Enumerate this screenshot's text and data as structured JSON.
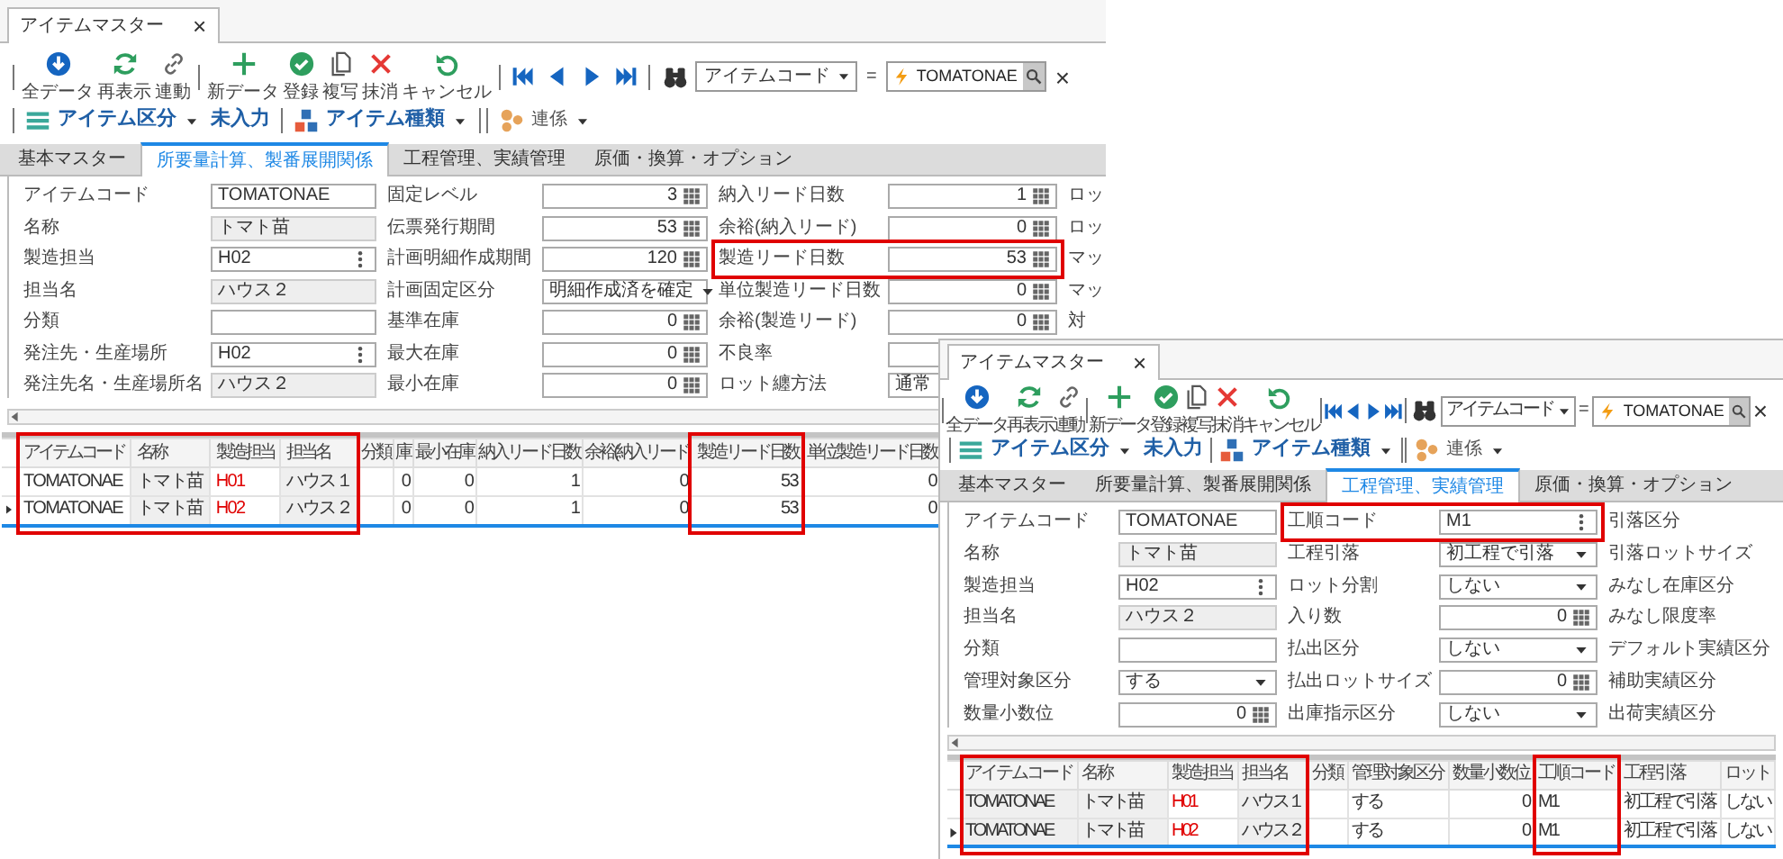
{
  "windows": [
    {
      "title": "アイテムマスター",
      "close": "×",
      "toolbar_groups": [
        [
          {
            "label": "全データ",
            "kind": "download"
          },
          {
            "label": "再表示",
            "kind": "refresh"
          },
          {
            "label": "連動",
            "kind": "link"
          }
        ],
        [
          {
            "label": "新データ",
            "kind": "plus"
          },
          {
            "label": "登録",
            "kind": "check"
          },
          {
            "label": "複写",
            "kind": "copy"
          },
          {
            "label": "抹消",
            "kind": "delete"
          },
          {
            "label": "キャンセル",
            "kind": "undo"
          }
        ]
      ],
      "search": {
        "key": "アイテムコード",
        "operator": "=",
        "value": "TOMATONAE",
        "clear": "×"
      },
      "filters": [
        {
          "label": "アイテム区分",
          "kind": "list"
        },
        {
          "label": "未入力",
          "kind": "plain"
        },
        {
          "label": "アイテム種類",
          "kind": "blocks"
        },
        {
          "label": "連係",
          "kind": "circles"
        }
      ],
      "tabs": [
        {
          "label": "基本マスター",
          "selected": false
        },
        {
          "label": "所要量計算、製番展開関係",
          "selected": true
        },
        {
          "label": "工程管理、実績管理",
          "selected": false
        },
        {
          "label": "原価・換算・オプション",
          "selected": false
        }
      ],
      "form": [
        [
          {
            "label": "アイテムコード",
            "kind": "text",
            "value": "TOMATONAE",
            "highlighted": false
          },
          {
            "label": "名称",
            "kind": "readonly",
            "value": "トマト苗",
            "highlighted": false
          },
          {
            "label": "製造担当",
            "kind": "picker",
            "value": "H02",
            "highlighted": false
          },
          {
            "label": "担当名",
            "kind": "readonly",
            "value": "ハウス２",
            "highlighted": false
          },
          {
            "label": "分類",
            "kind": "text",
            "highlighted": false
          },
          {
            "label": "発注先・生産場所",
            "kind": "picker",
            "value": "H02",
            "highlighted": false
          },
          {
            "label": "発注先名・生産場所名",
            "kind": "readonly",
            "value": "ハウス２",
            "highlighted": false
          }
        ],
        [
          {
            "label": "固定レベル",
            "kind": "number",
            "value": "3",
            "highlighted": false
          },
          {
            "label": "伝票発行期間",
            "kind": "number",
            "value": "53",
            "highlighted": false
          },
          {
            "label": "計画明細作成期間",
            "kind": "number",
            "value": "120",
            "highlighted": false
          },
          {
            "label": "計画固定区分",
            "kind": "select",
            "value": "明細作成済を確定",
            "highlighted": false
          },
          {
            "label": "基準在庫",
            "kind": "number",
            "value": "0",
            "highlighted": false
          },
          {
            "label": "最大在庫",
            "kind": "number",
            "value": "0",
            "highlighted": false
          },
          {
            "label": "最小在庫",
            "kind": "number",
            "value": "0",
            "highlighted": false
          }
        ],
        [
          {
            "label": "納入リード日数",
            "kind": "number",
            "value": "1",
            "highlighted": false
          },
          {
            "label": "余裕(納入リード)",
            "kind": "number",
            "value": "0",
            "highlighted": false
          },
          {
            "label": "製造リード日数",
            "kind": "number",
            "value": "53",
            "highlighted": true
          },
          {
            "label": "単位製造リード日数",
            "kind": "number",
            "value": "0",
            "highlighted": false
          },
          {
            "label": "余裕(製造リード)",
            "kind": "number",
            "value": "0",
            "highlighted": false
          },
          {
            "label": "不良率",
            "kind": "number",
            "highlighted": false
          },
          {
            "label": "ロット纏方法",
            "kind": "select",
            "value": "通常",
            "highlighted": false
          }
        ],
        [
          {
            "label": "ロッ",
            "kind": "label_only",
            "highlighted": false
          },
          {
            "label": "ロッ",
            "kind": "label_only",
            "highlighted": false
          },
          {
            "label": "マッ",
            "kind": "label_only",
            "highlighted": false
          },
          {
            "label": "マッ",
            "kind": "label_only",
            "highlighted": false
          },
          {
            "label": "対",
            "kind": "label_only",
            "highlighted": false
          }
        ]
      ],
      "grid": {
        "columns": [
          {
            "label": "アイテムコード",
            "kind": "text",
            "readonly": false,
            "highlighted": true
          },
          {
            "label": "名称",
            "kind": "text",
            "readonly": true,
            "highlighted": true
          },
          {
            "label": "製造担当",
            "kind": "text",
            "readonly": false,
            "highlighted": true,
            "color": "#e00000"
          },
          {
            "label": "担当名",
            "kind": "text",
            "readonly": true,
            "highlighted": true
          },
          {
            "label": "分類",
            "kind": "text",
            "readonly": false,
            "highlighted": false
          },
          {
            "label": "庫",
            "kind": "number",
            "readonly": false,
            "highlighted": false
          },
          {
            "label": "最小在庫",
            "kind": "number",
            "readonly": false,
            "highlighted": false
          },
          {
            "label": "納入リード日数",
            "kind": "number",
            "readonly": false,
            "highlighted": false
          },
          {
            "label": "余裕(納入リード",
            "kind": "number",
            "readonly": false,
            "highlighted": false
          },
          {
            "label": "製造リード日数",
            "kind": "number",
            "readonly": false,
            "highlighted": true
          },
          {
            "label": "単位製造リード日数",
            "kind": "number",
            "readonly": false,
            "highlighted": false
          }
        ],
        "rows": [
          {
            "current": false,
            "cells": [
              "TOMATONAE",
              "トマト苗",
              "H01",
              "ハウス１",
              null,
              "0",
              "0",
              "1",
              "0",
              "53",
              "0"
            ]
          },
          {
            "current": true,
            "cells": [
              "TOMATONAE",
              "トマト苗",
              "H02",
              "ハウス２",
              null,
              "0",
              "0",
              "1",
              "0",
              "53",
              "0"
            ]
          }
        ]
      }
    },
    {
      "title": "アイテムマスター",
      "close": "×",
      "toolbar_groups": [
        [
          {
            "label": "全データ",
            "kind": "download"
          },
          {
            "label": "再表示",
            "kind": "refresh"
          },
          {
            "label": "連動",
            "kind": "link"
          }
        ],
        [
          {
            "label": "新データ",
            "kind": "plus"
          },
          {
            "label": "登録",
            "kind": "check"
          },
          {
            "label": "複写",
            "kind": "copy"
          },
          {
            "label": "抹消",
            "kind": "delete"
          },
          {
            "label": "キャンセル",
            "kind": "undo"
          }
        ]
      ],
      "search": {
        "key": "アイテムコード",
        "operator": "=",
        "value": "TOMATONAE",
        "clear": "×"
      },
      "filters": [
        {
          "label": "アイテム区分",
          "kind": "list"
        },
        {
          "label": "未入力",
          "kind": "plain"
        },
        {
          "label": "アイテム種類",
          "kind": "blocks"
        },
        {
          "label": "連係",
          "kind": "circles"
        }
      ],
      "tabs": [
        {
          "label": "基本マスター",
          "selected": false
        },
        {
          "label": "所要量計算、製番展開関係",
          "selected": false
        },
        {
          "label": "工程管理、実績管理",
          "selected": true
        },
        {
          "label": "原価・換算・オプション",
          "selected": false
        }
      ],
      "form": [
        [
          {
            "label": "アイテムコード",
            "kind": "text",
            "value": "TOMATONAE",
            "highlighted": false
          },
          {
            "label": "名称",
            "kind": "readonly",
            "value": "トマト苗",
            "highlighted": false
          },
          {
            "label": "製造担当",
            "kind": "picker",
            "value": "H02",
            "highlighted": false
          },
          {
            "label": "担当名",
            "kind": "readonly",
            "value": "ハウス２",
            "highlighted": false
          },
          {
            "label": "分類",
            "kind": "text",
            "highlighted": false
          },
          {
            "label": "管理対象区分",
            "kind": "select",
            "value": "する",
            "highlighted": false
          },
          {
            "label": "数量小数位",
            "kind": "number",
            "value": "0",
            "highlighted": false
          }
        ],
        [
          {
            "label": "工順コード",
            "kind": "picker",
            "value": "M1",
            "highlighted": true
          },
          {
            "label": "工程引落",
            "kind": "select",
            "value": "初工程で引落",
            "highlighted": false
          },
          {
            "label": "ロット分割",
            "kind": "select",
            "value": "しない",
            "highlighted": false
          },
          {
            "label": "入り数",
            "kind": "number",
            "value": "0",
            "highlighted": false
          },
          {
            "label": "払出区分",
            "kind": "select",
            "value": "しない",
            "highlighted": false
          },
          {
            "label": "払出ロットサイズ",
            "kind": "number",
            "value": "0",
            "highlighted": false
          },
          {
            "label": "出庫指示区分",
            "kind": "select",
            "value": "しない",
            "highlighted": false
          }
        ],
        [
          {
            "label": "引落区分",
            "kind": "label_only",
            "highlighted": false
          },
          {
            "label": "引落ロットサイズ",
            "kind": "label_only",
            "highlighted": false
          },
          {
            "label": "みなし在庫区分",
            "kind": "label_only",
            "highlighted": false
          },
          {
            "label": "みなし限度率",
            "kind": "label_only",
            "highlighted": false
          },
          {
            "label": "デフォルト実績区分",
            "kind": "label_only",
            "highlighted": false
          },
          {
            "label": "補助実績区分",
            "kind": "label_only",
            "highlighted": false
          },
          {
            "label": "出荷実績区分",
            "kind": "label_only",
            "highlighted": false
          }
        ]
      ],
      "grid": {
        "columns": [
          {
            "label": "アイテムコード",
            "kind": "text",
            "readonly": true,
            "highlighted": true
          },
          {
            "label": "名称",
            "kind": "text",
            "readonly": true,
            "highlighted": true
          },
          {
            "label": "製造担当",
            "kind": "text",
            "readonly": false,
            "highlighted": true,
            "color": "#e00000"
          },
          {
            "label": "担当名",
            "kind": "text",
            "readonly": true,
            "highlighted": true
          },
          {
            "label": "分類",
            "kind": "text",
            "readonly": false,
            "highlighted": false
          },
          {
            "label": "管理対象区分",
            "kind": "text",
            "readonly": false,
            "highlighted": false
          },
          {
            "label": "数量小数位",
            "kind": "number",
            "readonly": false,
            "highlighted": false
          },
          {
            "label": "工順コード",
            "kind": "text",
            "readonly": false,
            "highlighted": true
          },
          {
            "label": "工程引落",
            "kind": "text",
            "readonly": false,
            "highlighted": false
          },
          {
            "label": "ロット",
            "kind": "text",
            "readonly": false,
            "highlighted": false
          }
        ],
        "rows": [
          {
            "current": false,
            "cells": [
              "TOMATONAE",
              "トマト苗",
              "H01",
              "ハウス１",
              null,
              "する",
              "0",
              "M1",
              "初工程で引落",
              "しない"
            ]
          },
          {
            "current": true,
            "cells": [
              "TOMATONAE",
              "トマト苗",
              "H02",
              "ハウス２",
              null,
              "する",
              "0",
              "M1",
              "初工程で引落",
              "しない"
            ]
          }
        ]
      }
    }
  ]
}
